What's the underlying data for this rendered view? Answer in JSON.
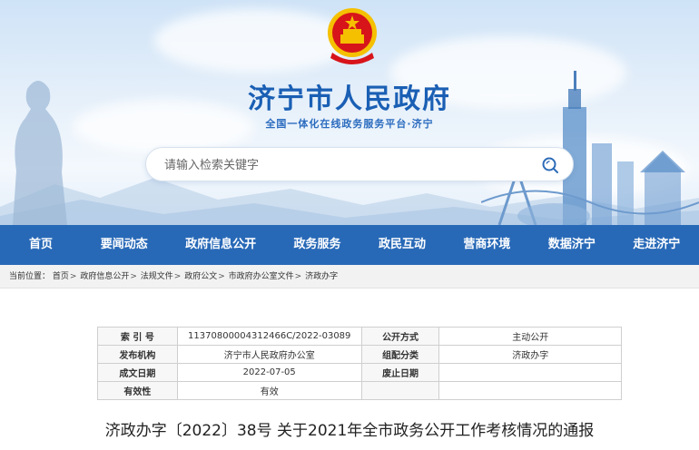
{
  "site": {
    "title": "济宁市人民政府",
    "subtitle": "全国一体化在线政务服务平台·济宁"
  },
  "search": {
    "placeholder": "请输入检索关键字",
    "icon": "search-icon"
  },
  "nav": {
    "items": [
      "首页",
      "要闻动态",
      "政府信息公开",
      "政务服务",
      "政民互动",
      "营商环境",
      "数据济宁",
      "走进济宁"
    ]
  },
  "breadcrumb": {
    "prefix": "当前位置：",
    "items": [
      "首页",
      "政府信息公开",
      "法规文件",
      "政府公文",
      "市政府办公室文件",
      "济政办字"
    ]
  },
  "info": {
    "rows": [
      {
        "k1": "索 引 号",
        "v1": "11370800004312466C/2022-03089",
        "k2": "公开方式",
        "v2": "主动公开"
      },
      {
        "k1": "发布机构",
        "v1": "济宁市人民政府办公室",
        "k2": "组配分类",
        "v2": "济政办字"
      },
      {
        "k1": "成文日期",
        "v1": "2022-07-05",
        "k2": "废止日期",
        "v2": ""
      },
      {
        "k1": "有效性",
        "v1": "有效",
        "k2": "",
        "v2": ""
      }
    ]
  },
  "document": {
    "title": "济政办字〔2022〕38号 关于2021年全市政务公开工作考核情况的通报"
  },
  "colors": {
    "nav_bg": "#2869b7",
    "title_blue": "#1a5fb4",
    "emblem_red": "#d7141a",
    "emblem_gold": "#f5c000"
  }
}
